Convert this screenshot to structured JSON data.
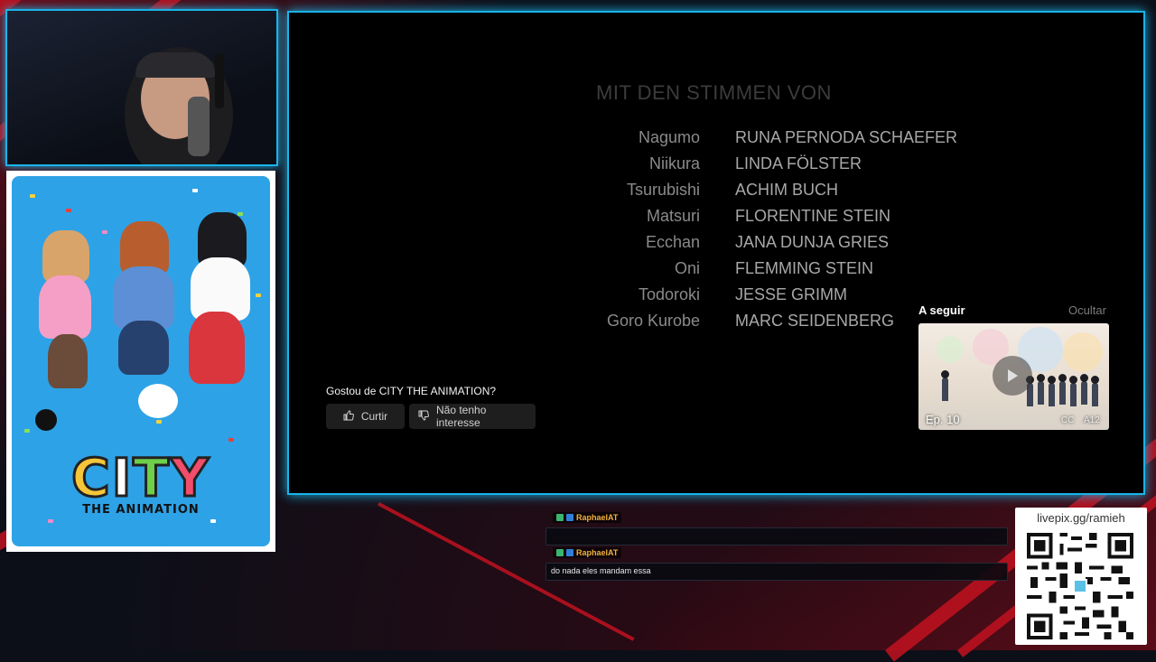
{
  "poster": {
    "title": "CITY",
    "subtitle": "THE ANIMATION"
  },
  "player": {
    "credits_heading": "MIT DEN STIMMEN VON",
    "credits": [
      {
        "role": "Nagumo",
        "actor": "RUNA PERNODA SCHAEFER"
      },
      {
        "role": "Niikura",
        "actor": "LINDA FÖLSTER"
      },
      {
        "role": "Tsurubishi",
        "actor": "ACHIM BUCH"
      },
      {
        "role": "Matsuri",
        "actor": "FLORENTINE STEIN"
      },
      {
        "role": "Ecchan",
        "actor": "JANA DUNJA GRIES"
      },
      {
        "role": "Oni",
        "actor": "FLEMMING STEIN"
      },
      {
        "role": "Todoroki",
        "actor": "JESSE GRIMM"
      },
      {
        "role": "Goro Kurobe",
        "actor": "MARC SEIDENBERG"
      }
    ],
    "feedback_question": "Gostou de CITY THE ANIMATION?",
    "like_label": "Curtir",
    "dislike_label": "Não tenho interesse",
    "next": {
      "label": "A seguir",
      "hide_label": "Ocultar",
      "episode": "Ep. 10",
      "cc": "CC",
      "rating": "A12"
    }
  },
  "chat": {
    "messages": [
      {
        "user": "RaphaelAT",
        "text": ""
      },
      {
        "user": "RaphaelAT",
        "text": "do nada eles mandam essa"
      }
    ]
  },
  "qr": {
    "label": "livepix.gg/ramieh"
  },
  "colors": {
    "accent_cyan": "#1ab4e8",
    "stream_red": "#c2121f",
    "username": "#f0b23c"
  }
}
